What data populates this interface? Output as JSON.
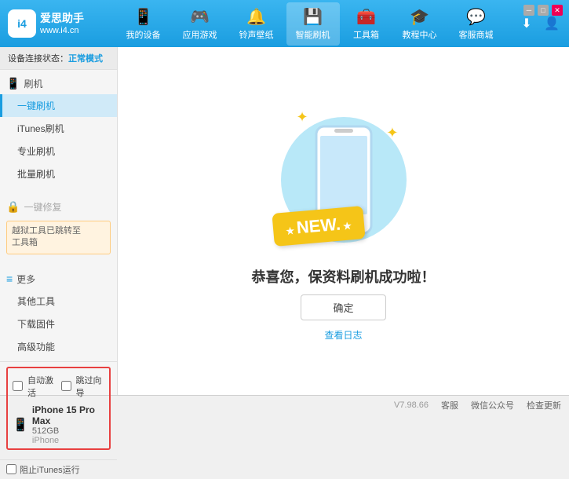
{
  "header": {
    "logo_abbr": "i4",
    "logo_brand": "爱思助手",
    "logo_url": "www.i4.cn",
    "nav_items": [
      {
        "id": "my-device",
        "label": "我的设备",
        "icon": "📱"
      },
      {
        "id": "apps-games",
        "label": "应用游戏",
        "icon": "🎮"
      },
      {
        "id": "ringtones",
        "label": "铃声壁纸",
        "icon": "🎵"
      },
      {
        "id": "smart-flash",
        "label": "智能刷机",
        "icon": "🔄",
        "active": true
      },
      {
        "id": "toolbox",
        "label": "工具箱",
        "icon": "🧰"
      },
      {
        "id": "tutorial",
        "label": "教程中心",
        "icon": "🎓"
      },
      {
        "id": "service",
        "label": "客服商城",
        "icon": "💬"
      }
    ],
    "download_icon": "⬇",
    "user_icon": "👤"
  },
  "status_bar": {
    "label": "设备连接状态：",
    "value": "正常模式"
  },
  "sidebar": {
    "flash_group": {
      "icon": "📱",
      "label": "刷机"
    },
    "flash_items": [
      {
        "id": "one-click-flash",
        "label": "一键刷机",
        "active": true
      },
      {
        "id": "itunes-flash",
        "label": "iTunes刷机"
      },
      {
        "id": "pro-flash",
        "label": "专业刷机"
      },
      {
        "id": "batch-flash",
        "label": "批量刷机"
      }
    ],
    "recovery_group": {
      "icon": "🔧",
      "label": "一键修复",
      "disabled": true
    },
    "recovery_notice": "越狱工具已跳转至\n工具箱",
    "more_group": {
      "icon": "≡",
      "label": "更多"
    },
    "more_items": [
      {
        "id": "other-tools",
        "label": "其他工具"
      },
      {
        "id": "download-firmware",
        "label": "下载固件"
      },
      {
        "id": "advanced",
        "label": "高级功能"
      }
    ],
    "auto_activate_label": "自动激活",
    "guide_label": "跳过向导",
    "device": {
      "name": "iPhone 15 Pro Max",
      "storage": "512GB",
      "type": "iPhone"
    },
    "itunes_label": "阻止iTunes运行"
  },
  "main": {
    "success_text": "恭喜您，保资料刷机成功啦！",
    "confirm_label": "确定",
    "log_label": "查看日志"
  },
  "footer": {
    "version": "V7.98.66",
    "items": [
      "客服",
      "微信公众号",
      "检查更新"
    ]
  },
  "colors": {
    "primary": "#1a9de0",
    "accent": "#f5c518",
    "danger": "#e84040"
  }
}
